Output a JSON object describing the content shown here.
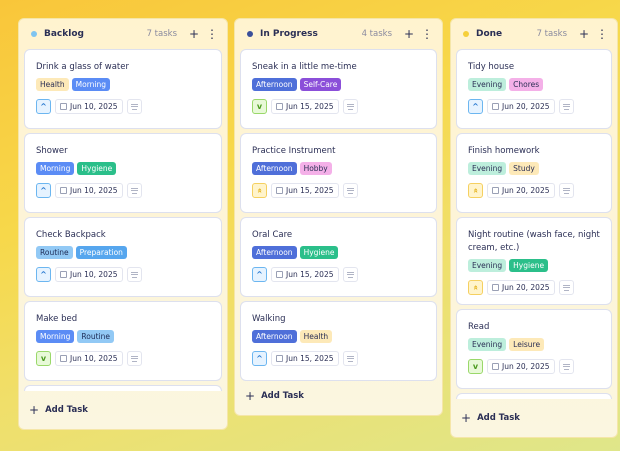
{
  "tag_colors": {
    "Health": [
      "#fde9b8",
      "#2b2f55"
    ],
    "Morning": [
      "#5b8cf5",
      "#fff"
    ],
    "Hygiene": [
      "#2bbf8a",
      "#fff"
    ],
    "Routine": [
      "#92c9f5",
      "#1d2b55"
    ],
    "Preparation": [
      "#56a6ee",
      "#fff"
    ],
    "Afternoon": [
      "#4f6fd9",
      "#fff"
    ],
    "Self-Care": [
      "#8b4fd9",
      "#fff"
    ],
    "Hobby": [
      "#f4b0e8",
      "#2b2f55"
    ],
    "Evening": [
      "#bdeedc",
      "#2b2f55"
    ],
    "Chores": [
      "#f4b0e8",
      "#2b2f55"
    ],
    "Study": [
      "#fde9b8",
      "#2b2f55"
    ],
    "Leisure": [
      "#fde9b8",
      "#2b2f55"
    ]
  },
  "priority_styles": {
    "medium": {
      "icon": "chevron-up-icon",
      "glyph": "^",
      "bg": "#e6f3ff",
      "border": "#6cb6f0",
      "color": "#2a7ad0"
    },
    "low": {
      "icon": "chevron-down-icon",
      "glyph": "v",
      "bg": "#e8f9d8",
      "border": "#9ad86a",
      "color": "#4a9a1e"
    },
    "high": {
      "icon": "double-chevron-up-icon",
      "glyph": "»",
      "bg": "#fff4cc",
      "border": "#f5d060",
      "color": "#e0a800"
    }
  },
  "add_task_label": "Add Task",
  "columns": [
    {
      "title": "Backlog",
      "count": "7 tasks",
      "dot": "#7fc4f0",
      "cards": [
        {
          "title": "Drink a glass of water",
          "tags": [
            "Health",
            "Morning"
          ],
          "priority": "medium",
          "date": "Jun 10, 2025"
        },
        {
          "title": "Shower",
          "tags": [
            "Morning",
            "Hygiene"
          ],
          "priority": "medium",
          "date": "Jun 10, 2025"
        },
        {
          "title": "Check Backpack",
          "tags": [
            "Routine",
            "Preparation"
          ],
          "priority": "medium",
          "date": "Jun 10, 2025"
        },
        {
          "title": "Make bed",
          "tags": [
            "Morning",
            "Routine"
          ],
          "priority": "low",
          "date": "Jun 10, 2025"
        }
      ]
    },
    {
      "title": "In Progress",
      "count": "4 tasks",
      "dot": "#3a4f9a",
      "cards": [
        {
          "title": "Sneak in a little me-time",
          "tags": [
            "Afternoon",
            "Self-Care"
          ],
          "priority": "low",
          "date": "Jun 15, 2025"
        },
        {
          "title": "Practice Instrument",
          "tags": [
            "Afternoon",
            "Hobby"
          ],
          "priority": "high",
          "date": "Jun 15, 2025"
        },
        {
          "title": "Oral Care",
          "tags": [
            "Afternoon",
            "Hygiene"
          ],
          "priority": "medium",
          "date": "Jun 15, 2025"
        },
        {
          "title": "Walking",
          "tags": [
            "Afternoon",
            "Health"
          ],
          "priority": "medium",
          "date": "Jun 15, 2025"
        }
      ]
    },
    {
      "title": "Done",
      "count": "7 tasks",
      "dot": "#f5cf3a",
      "cards": [
        {
          "title": "Tidy house",
          "tags": [
            "Evening",
            "Chores"
          ],
          "priority": "medium",
          "date": "Jun 20, 2025"
        },
        {
          "title": "Finish homework",
          "tags": [
            "Evening",
            "Study"
          ],
          "priority": "high",
          "date": "Jun 20, 2025"
        },
        {
          "title": "Night routine (wash face, night cream, etc.)",
          "tags": [
            "Evening",
            "Hygiene"
          ],
          "priority": "high",
          "date": "Jun 20, 2025"
        },
        {
          "title": "Read",
          "tags": [
            "Evening",
            "Leisure"
          ],
          "priority": "low",
          "date": "Jun 20, 2025"
        }
      ]
    }
  ]
}
